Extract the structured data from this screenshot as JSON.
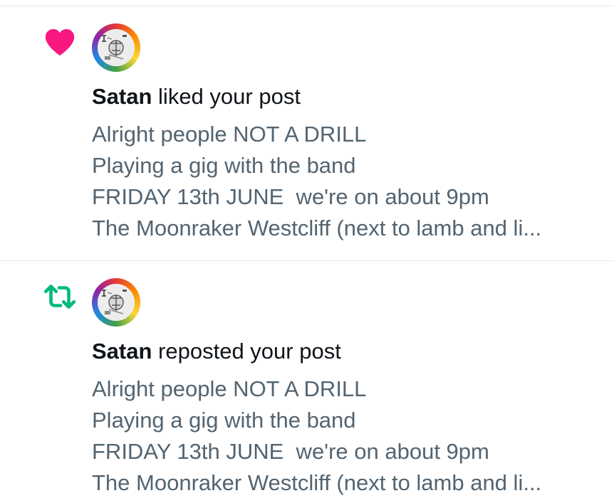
{
  "notifications": [
    {
      "type": "like",
      "icon": "heart-icon",
      "icon_color": "#f91880",
      "user": "Satan",
      "action": "liked your post",
      "post_lines": [
        "Alright people NOT A DRILL",
        "Playing a gig with the band",
        "FRIDAY 13th JUNE  we're on about 9pm",
        "The Moonraker Westcliff (next to lamb and li..."
      ]
    },
    {
      "type": "repost",
      "icon": "repost-icon",
      "icon_color": "#00ba7c",
      "user": "Satan",
      "action": "reposted your post",
      "post_lines": [
        "Alright people NOT A DRILL",
        "Playing a gig with the band",
        "FRIDAY 13th JUNE  we're on about 9pm",
        "The Moonraker Westcliff (next to lamb and li..."
      ]
    }
  ],
  "colors": {
    "name_text": "#0f1419",
    "post_text": "#536471",
    "divider": "#e6e9ec",
    "avatar_ring": "rainbow"
  }
}
